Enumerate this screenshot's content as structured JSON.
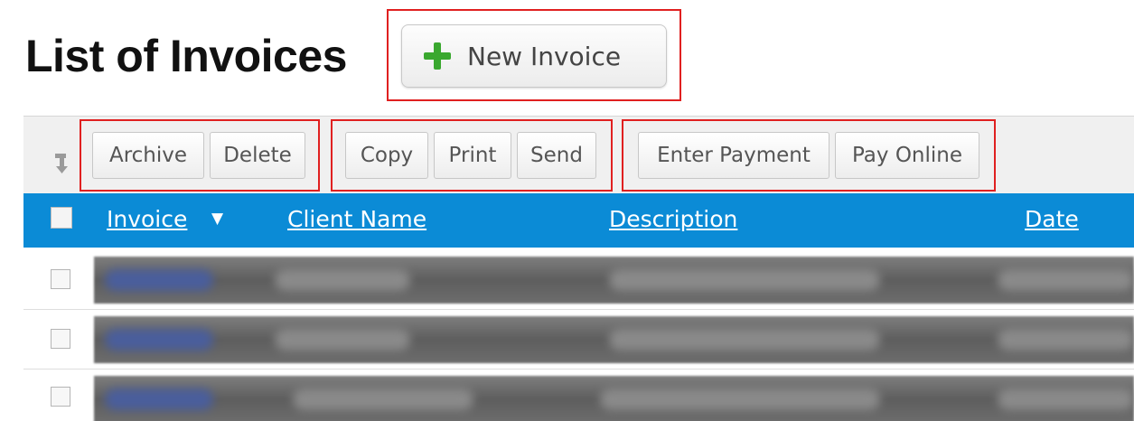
{
  "page": {
    "title": "List of Invoices"
  },
  "actions": {
    "new_invoice": "New Invoice"
  },
  "toolbar": {
    "archive": "Archive",
    "delete": "Delete",
    "copy": "Copy",
    "print": "Print",
    "send": "Send",
    "enter_payment": "Enter Payment",
    "pay_online": "Pay Online"
  },
  "table": {
    "columns": {
      "invoice": "Invoice",
      "client_name": "Client Name",
      "description": "Description",
      "date": "Date"
    },
    "sort": {
      "column": "invoice",
      "direction": "descending",
      "indicator": "▼"
    },
    "row_count_visible": 3
  },
  "colors": {
    "header_blue": "#0b8bd6",
    "highlight_red": "#e02020",
    "plus_green": "#3aa82f"
  },
  "icons": [
    "plus-icon",
    "sort-icon",
    "dropdown-caret-icon"
  ]
}
